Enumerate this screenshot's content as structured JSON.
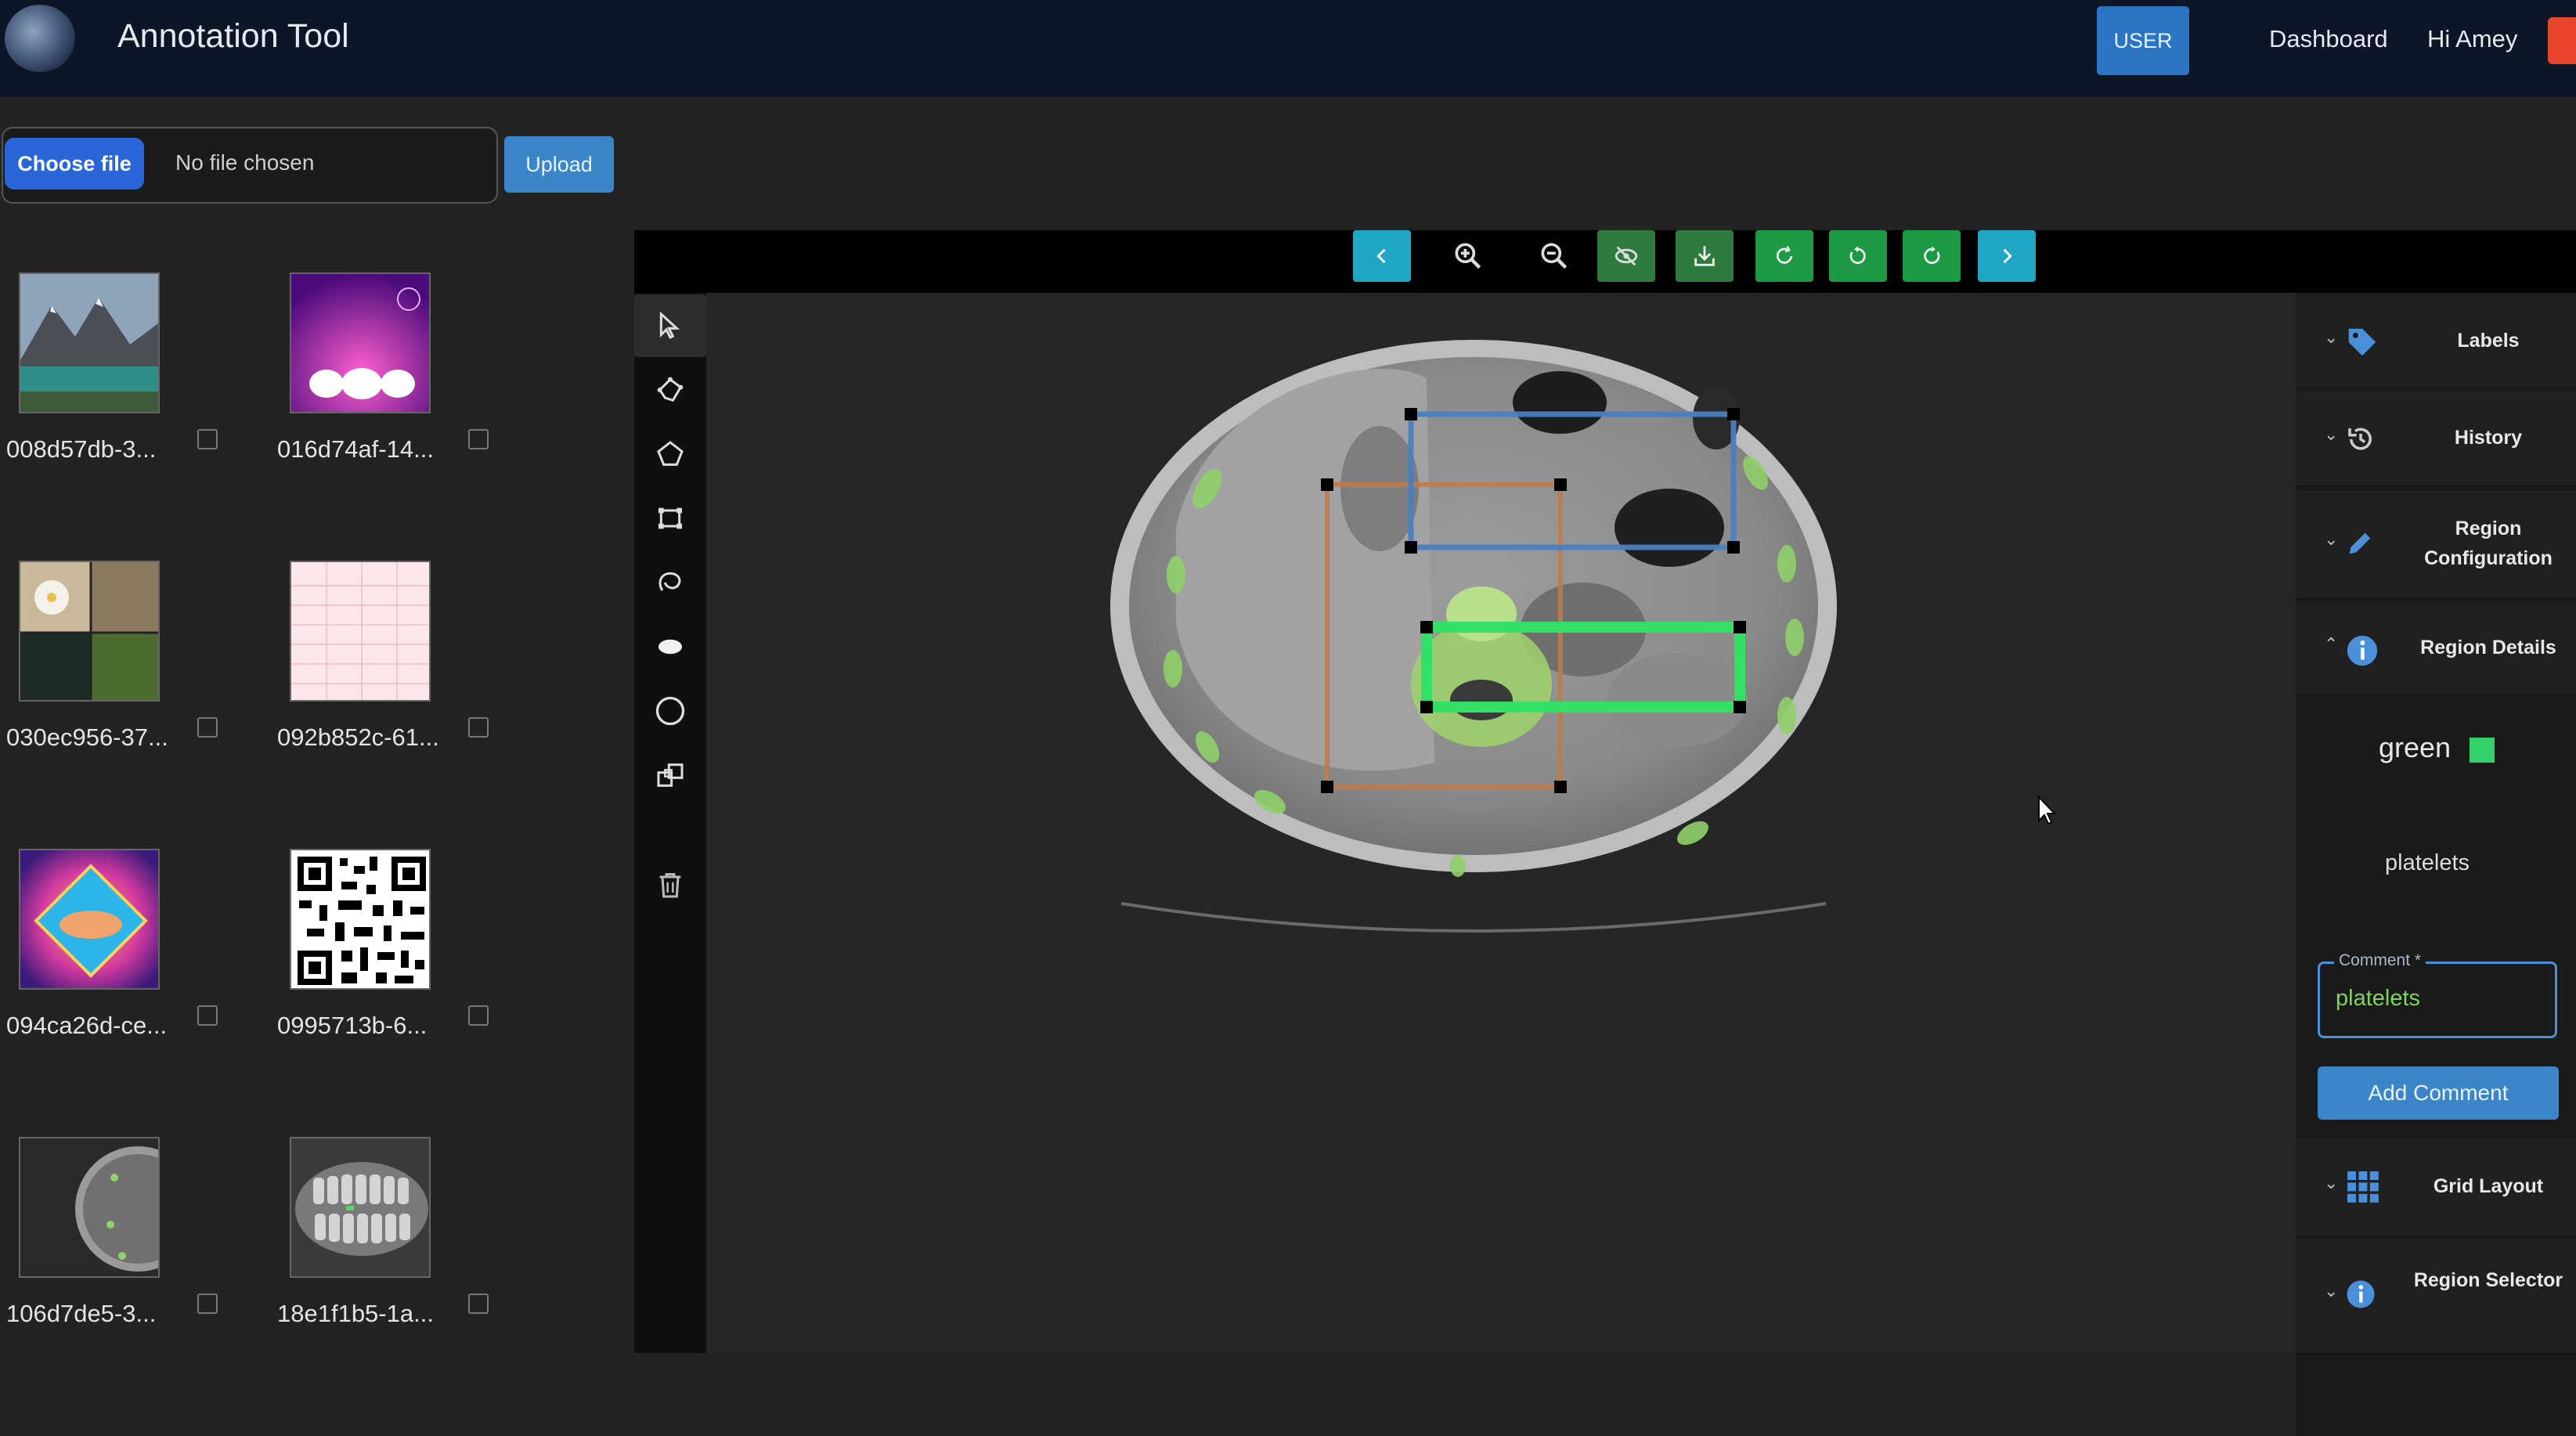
{
  "header": {
    "app_title": "Annotation Tool",
    "user_badge": "USER",
    "nav_dashboard": "Dashboard",
    "nav_greeting": "Hi Amey"
  },
  "upload": {
    "choose_label": "Choose file",
    "file_status": "No file chosen",
    "upload_label": "Upload"
  },
  "gallery": [
    {
      "label": "008d57db-3...",
      "thumb": "mountain-lake-photo"
    },
    {
      "label": "016d74af-14...",
      "thumb": "purple-glow-photo"
    },
    {
      "label": "030ec956-37...",
      "thumb": "flowers-collage-photo"
    },
    {
      "label": "092b852c-61...",
      "thumb": "pink-grid-document"
    },
    {
      "label": "094ca26d-ce...",
      "thumb": "handshake-art"
    },
    {
      "label": "0995713b-6...",
      "thumb": "qr-code"
    },
    {
      "label": "106d7de5-3...",
      "thumb": "ct-scan-dark"
    },
    {
      "label": "18e1f1b5-1a...",
      "thumb": "dental-xray"
    }
  ],
  "tools": [
    "select-icon",
    "polygon-pen-icon",
    "pentagon-icon",
    "bounding-box-icon",
    "lasso-icon",
    "ellipse-icon",
    "circle-icon",
    "multi-box-icon",
    "trash-icon"
  ],
  "toolbar": [
    "prev-icon",
    "zoom-in-icon",
    "zoom-out-icon",
    "hide-icon",
    "save-icon",
    "refresh-icon",
    "rotate-left-icon",
    "rotate-right-icon",
    "next-icon"
  ],
  "right_panel": {
    "labels": "Labels",
    "history": "History",
    "region_configuration": "Region Configuration",
    "region_details": "Region Details",
    "region_color_name": "green",
    "region_color": "#33d16a",
    "region_label": "platelets",
    "comment_legend": "Comment *",
    "comment_value": "platelets",
    "add_comment": "Add Comment",
    "grid_layout": "Grid Layout",
    "region_selector": "Region Selector"
  },
  "regions": [
    {
      "name": "blue-region",
      "color": "#4a7fc1"
    },
    {
      "name": "orange-region",
      "color": "#c17a4a"
    },
    {
      "name": "green-region",
      "color": "#33e066"
    }
  ]
}
